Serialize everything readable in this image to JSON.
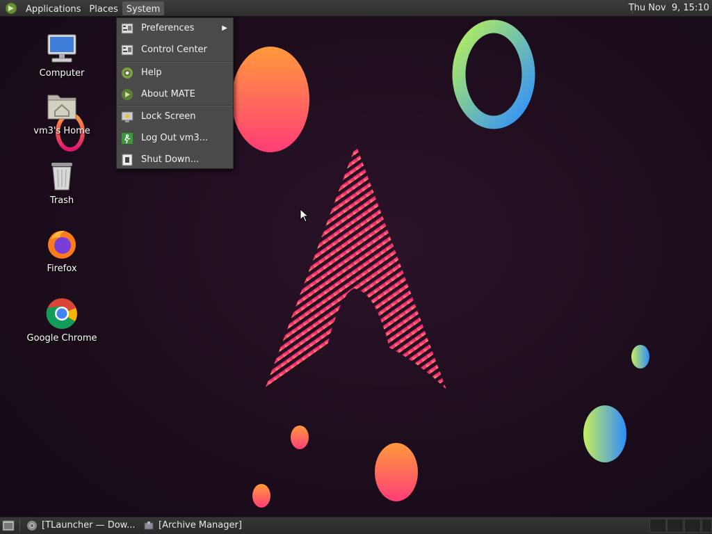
{
  "top_panel": {
    "menus": [
      "Applications",
      "Places",
      "System"
    ],
    "clock": "Thu Nov  9, 15:10"
  },
  "desktop_icons": [
    {
      "label": "Computer",
      "icon": "computer-icon"
    },
    {
      "label": "vm3's Home",
      "icon": "home-folder-icon"
    },
    {
      "label": "Trash",
      "icon": "trash-icon"
    },
    {
      "label": "Firefox",
      "icon": "firefox-icon"
    },
    {
      "label": "Google Chrome",
      "icon": "chrome-icon"
    }
  ],
  "system_menu": {
    "items": [
      {
        "label": "Preferences",
        "icon": "preferences-icon",
        "submenu": true
      },
      {
        "label": "Control Center",
        "icon": "control-center-icon"
      },
      {
        "label": "Help",
        "icon": "help-icon"
      },
      {
        "label": "About MATE",
        "icon": "mate-icon"
      },
      {
        "label": "Lock Screen",
        "icon": "lock-screen-icon"
      },
      {
        "label": "Log Out vm3...",
        "icon": "logout-icon"
      },
      {
        "label": "Shut Down...",
        "icon": "shutdown-icon"
      }
    ],
    "submenu_arrow": "▶"
  },
  "taskbar": {
    "tasks": [
      {
        "label": "[TLauncher — Dow...",
        "icon": "chrome-icon"
      },
      {
        "label": "[Archive Manager]",
        "icon": "archive-manager-icon"
      }
    ]
  },
  "colors": {
    "panel": "#2e2e2e",
    "menu_bg": "#4a4a4a",
    "wallpaper": "#1c0d1c",
    "accent_pink": "#ff2d7a",
    "accent_orange": "#ff9a3c"
  }
}
